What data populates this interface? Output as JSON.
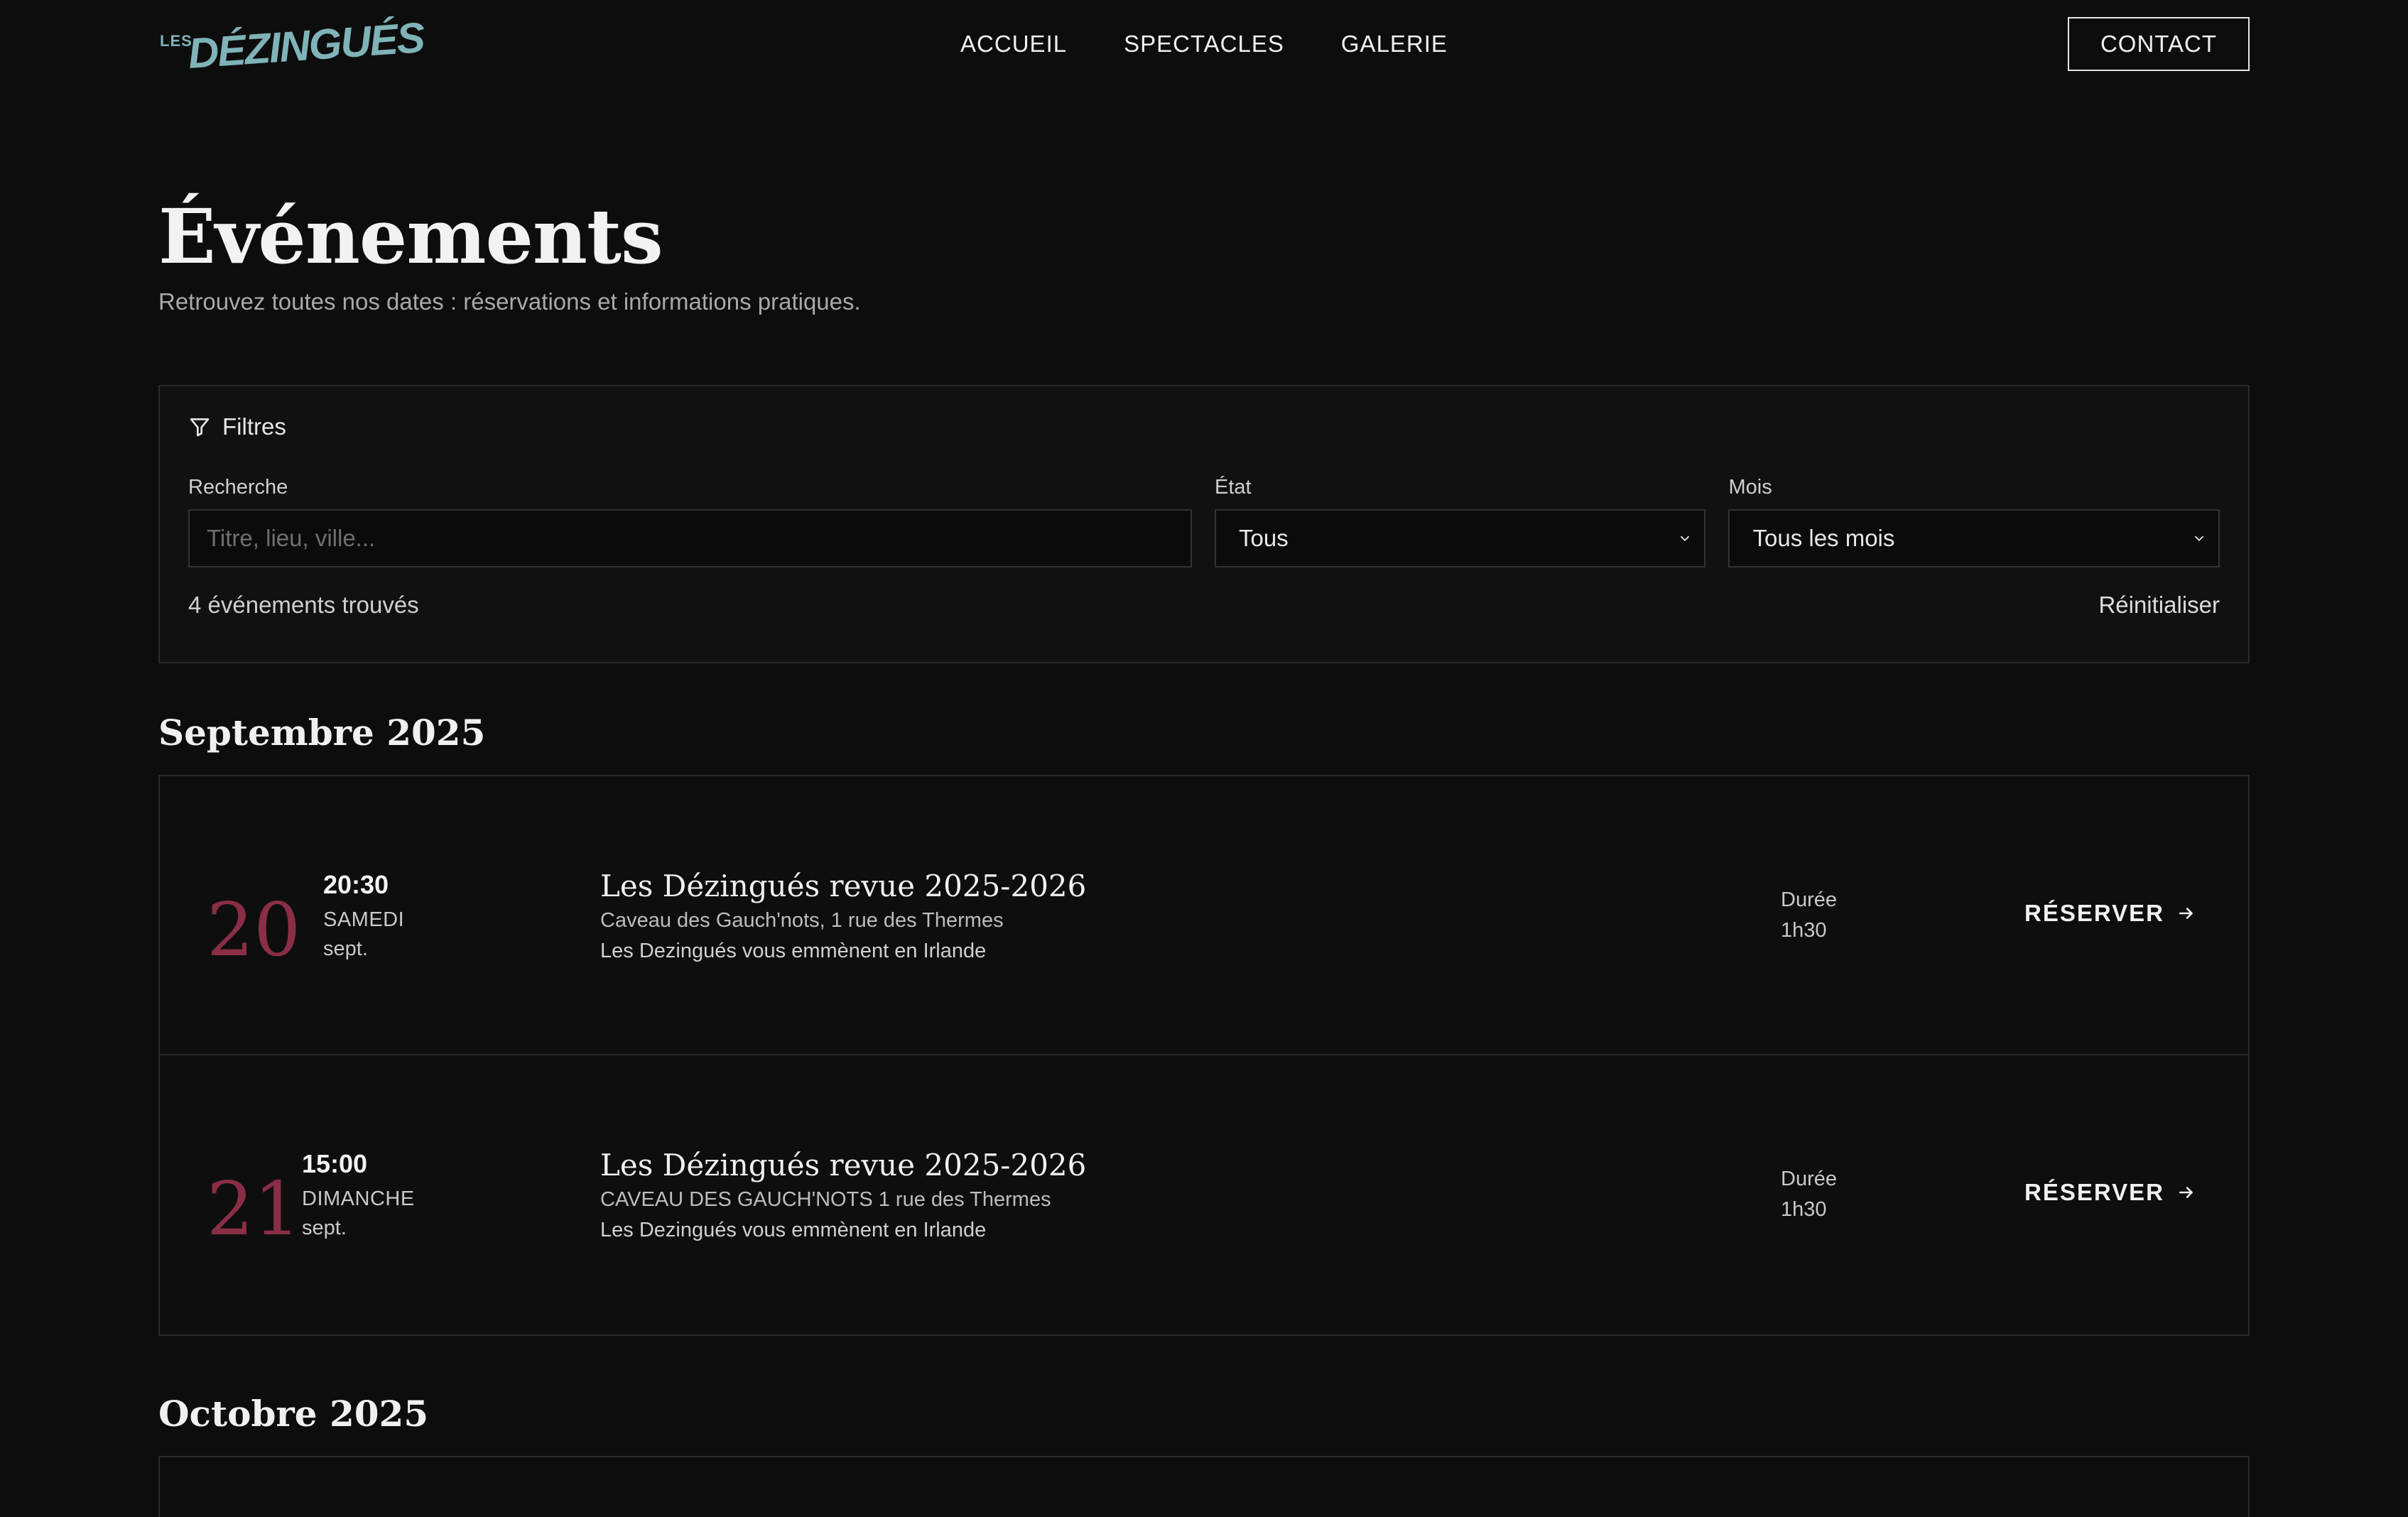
{
  "header": {
    "logo_small": "LES",
    "logo_main": "DÉZINGUÉS",
    "nav": [
      "ACCUEIL",
      "SPECTACLES",
      "GALERIE"
    ],
    "contact_label": "CONTACT"
  },
  "page": {
    "title": "Événements",
    "subtitle": "Retrouvez toutes nos dates : réservations et informations pratiques."
  },
  "filters": {
    "heading": "Filtres",
    "search_label": "Recherche",
    "search_placeholder": "Titre, lieu, ville...",
    "state_label": "État",
    "state_value": "Tous",
    "month_label": "Mois",
    "month_value": "Tous les mois",
    "count_text": "4 événements trouvés",
    "reset_label": "Réinitialiser"
  },
  "months": [
    {
      "title": "Septembre 2025",
      "events": [
        {
          "day": "20",
          "time": "20:30",
          "weekday": "SAMEDI",
          "month": "sept.",
          "title": "Les Dézingués revue 2025-2026",
          "place": "Caveau des Gauch'nots, 1 rue des Thermes",
          "desc": "Les Dezingués vous emmènent en Irlande",
          "duration_label": "Durée",
          "duration": "1h30",
          "reserve_label": "RÉSERVER"
        },
        {
          "day": "21",
          "time": "15:00",
          "weekday": "DIMANCHE",
          "month": "sept.",
          "title": "Les Dézingués revue 2025-2026",
          "place": "CAVEAU DES GAUCH'NOTS 1 rue des Thermes",
          "desc": "Les Dezingués vous emmènent en Irlande",
          "duration_label": "Durée",
          "duration": "1h30",
          "reserve_label": "RÉSERVER"
        }
      ]
    },
    {
      "title": "Octobre 2025"
    }
  ],
  "colors": {
    "background": "#0d0d0d",
    "accent_day": "#8a2e46",
    "logo": "#7fb3b8"
  }
}
